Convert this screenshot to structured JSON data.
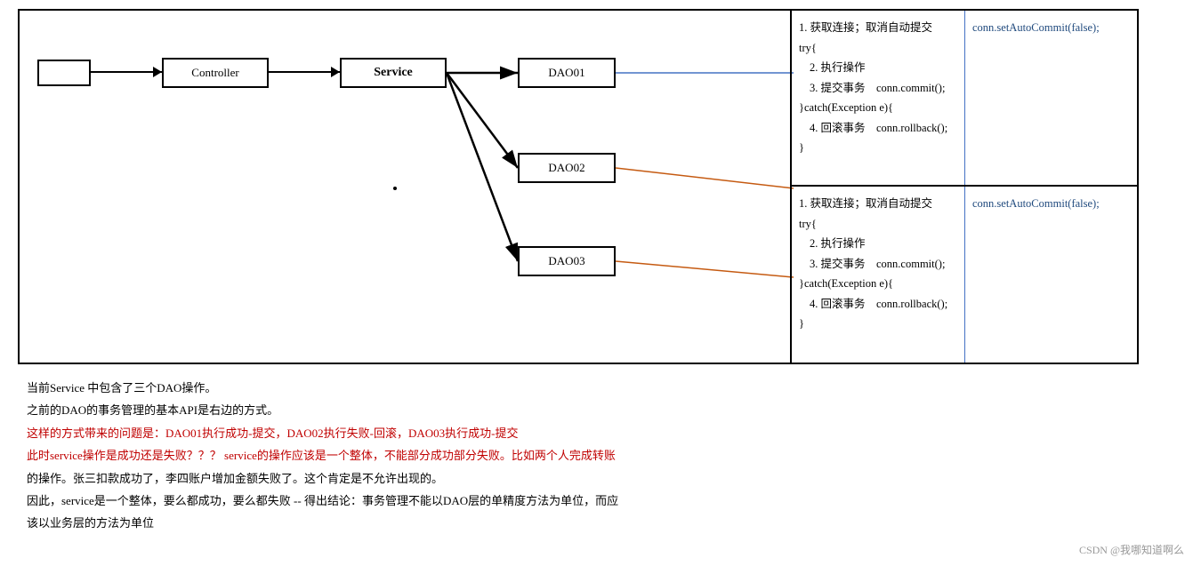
{
  "diagram": {
    "leftBox": "",
    "controllerLabel": "Controller",
    "serviceLabel": "Service",
    "dao01Label": "DAO01",
    "dao02Label": "DAO02",
    "dao03Label": "DAO03"
  },
  "transactionSection1": {
    "left": {
      "line1": "1. 获取连接；取消自动提交",
      "line2": "try{",
      "line3": "  2. 执行操作",
      "line4": "  3. 提交事务    conn.commit();",
      "line5": "}catch(Exception e){",
      "line6": "  4. 回滚事务    conn.rollback();",
      "line7": "}"
    },
    "right": "conn.setAutoCommit(false);"
  },
  "transactionSection2": {
    "left": {
      "line1": "1. 获取连接；取消自动提交",
      "line2": "try{",
      "line3": "  2. 执行操作",
      "line4": "  3. 提交事务    conn.commit();",
      "line5": "}catch(Exception e){",
      "line6": "  4. 回滚事务    conn.rollback();",
      "line7": "}"
    },
    "right": "conn.setAutoCommit(false);"
  },
  "description": {
    "line1": "当前Service 中包含了三个DAO操作。",
    "line2": "之前的DAO的事务管理的基本API是右边的方式。",
    "line3": "这样的方式带来的问题是：DAO01执行成功-提交，DAO02执行失败-回滚，DAO03执行成功-提交",
    "line4": "此时service操作是成功还是失败？？？  service的操作应该是一个整体，不能部分成功部分失败。比如两个人完成转账",
    "line5": "的操作。张三扣款成功了，李四账户增加金额失败了。这个肯定是不允许出现的。",
    "line6": "因此，service是一个整体，要么都成功，要么都失败 -- 得出结论：事务管理不能以DAO层的单精度方法为单位，而应",
    "line7": "该以业务层的方法为单位"
  },
  "watermark": "CSDN @我哪知道啊么"
}
